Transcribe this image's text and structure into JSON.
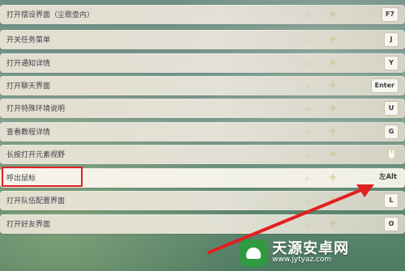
{
  "rows": [
    {
      "label": "打开摆设界面（尘歌壶内）",
      "key": "F7"
    },
    {
      "label": "开关任务菜单",
      "key": "J"
    },
    {
      "label": "打开通知详情",
      "key": "Y"
    },
    {
      "label": "打开聊天界面",
      "key": "Enter"
    },
    {
      "label": "打开特殊环境说明",
      "key": "U"
    },
    {
      "label": "查看教程详情",
      "key": "G"
    },
    {
      "label": "长按打开元素视野",
      "key": "mouse-middle-icon"
    },
    {
      "label": "呼出鼠标",
      "key": "左Alt"
    },
    {
      "label": "打开队伍配置界面",
      "key": "L"
    },
    {
      "label": "打开好友界面",
      "key": "O"
    }
  ],
  "annotation": {
    "box_color": "#e02020",
    "arrow_color": "#e02020"
  },
  "watermark": {
    "title": "天源安卓网",
    "url": "www.jytyaz.com"
  }
}
